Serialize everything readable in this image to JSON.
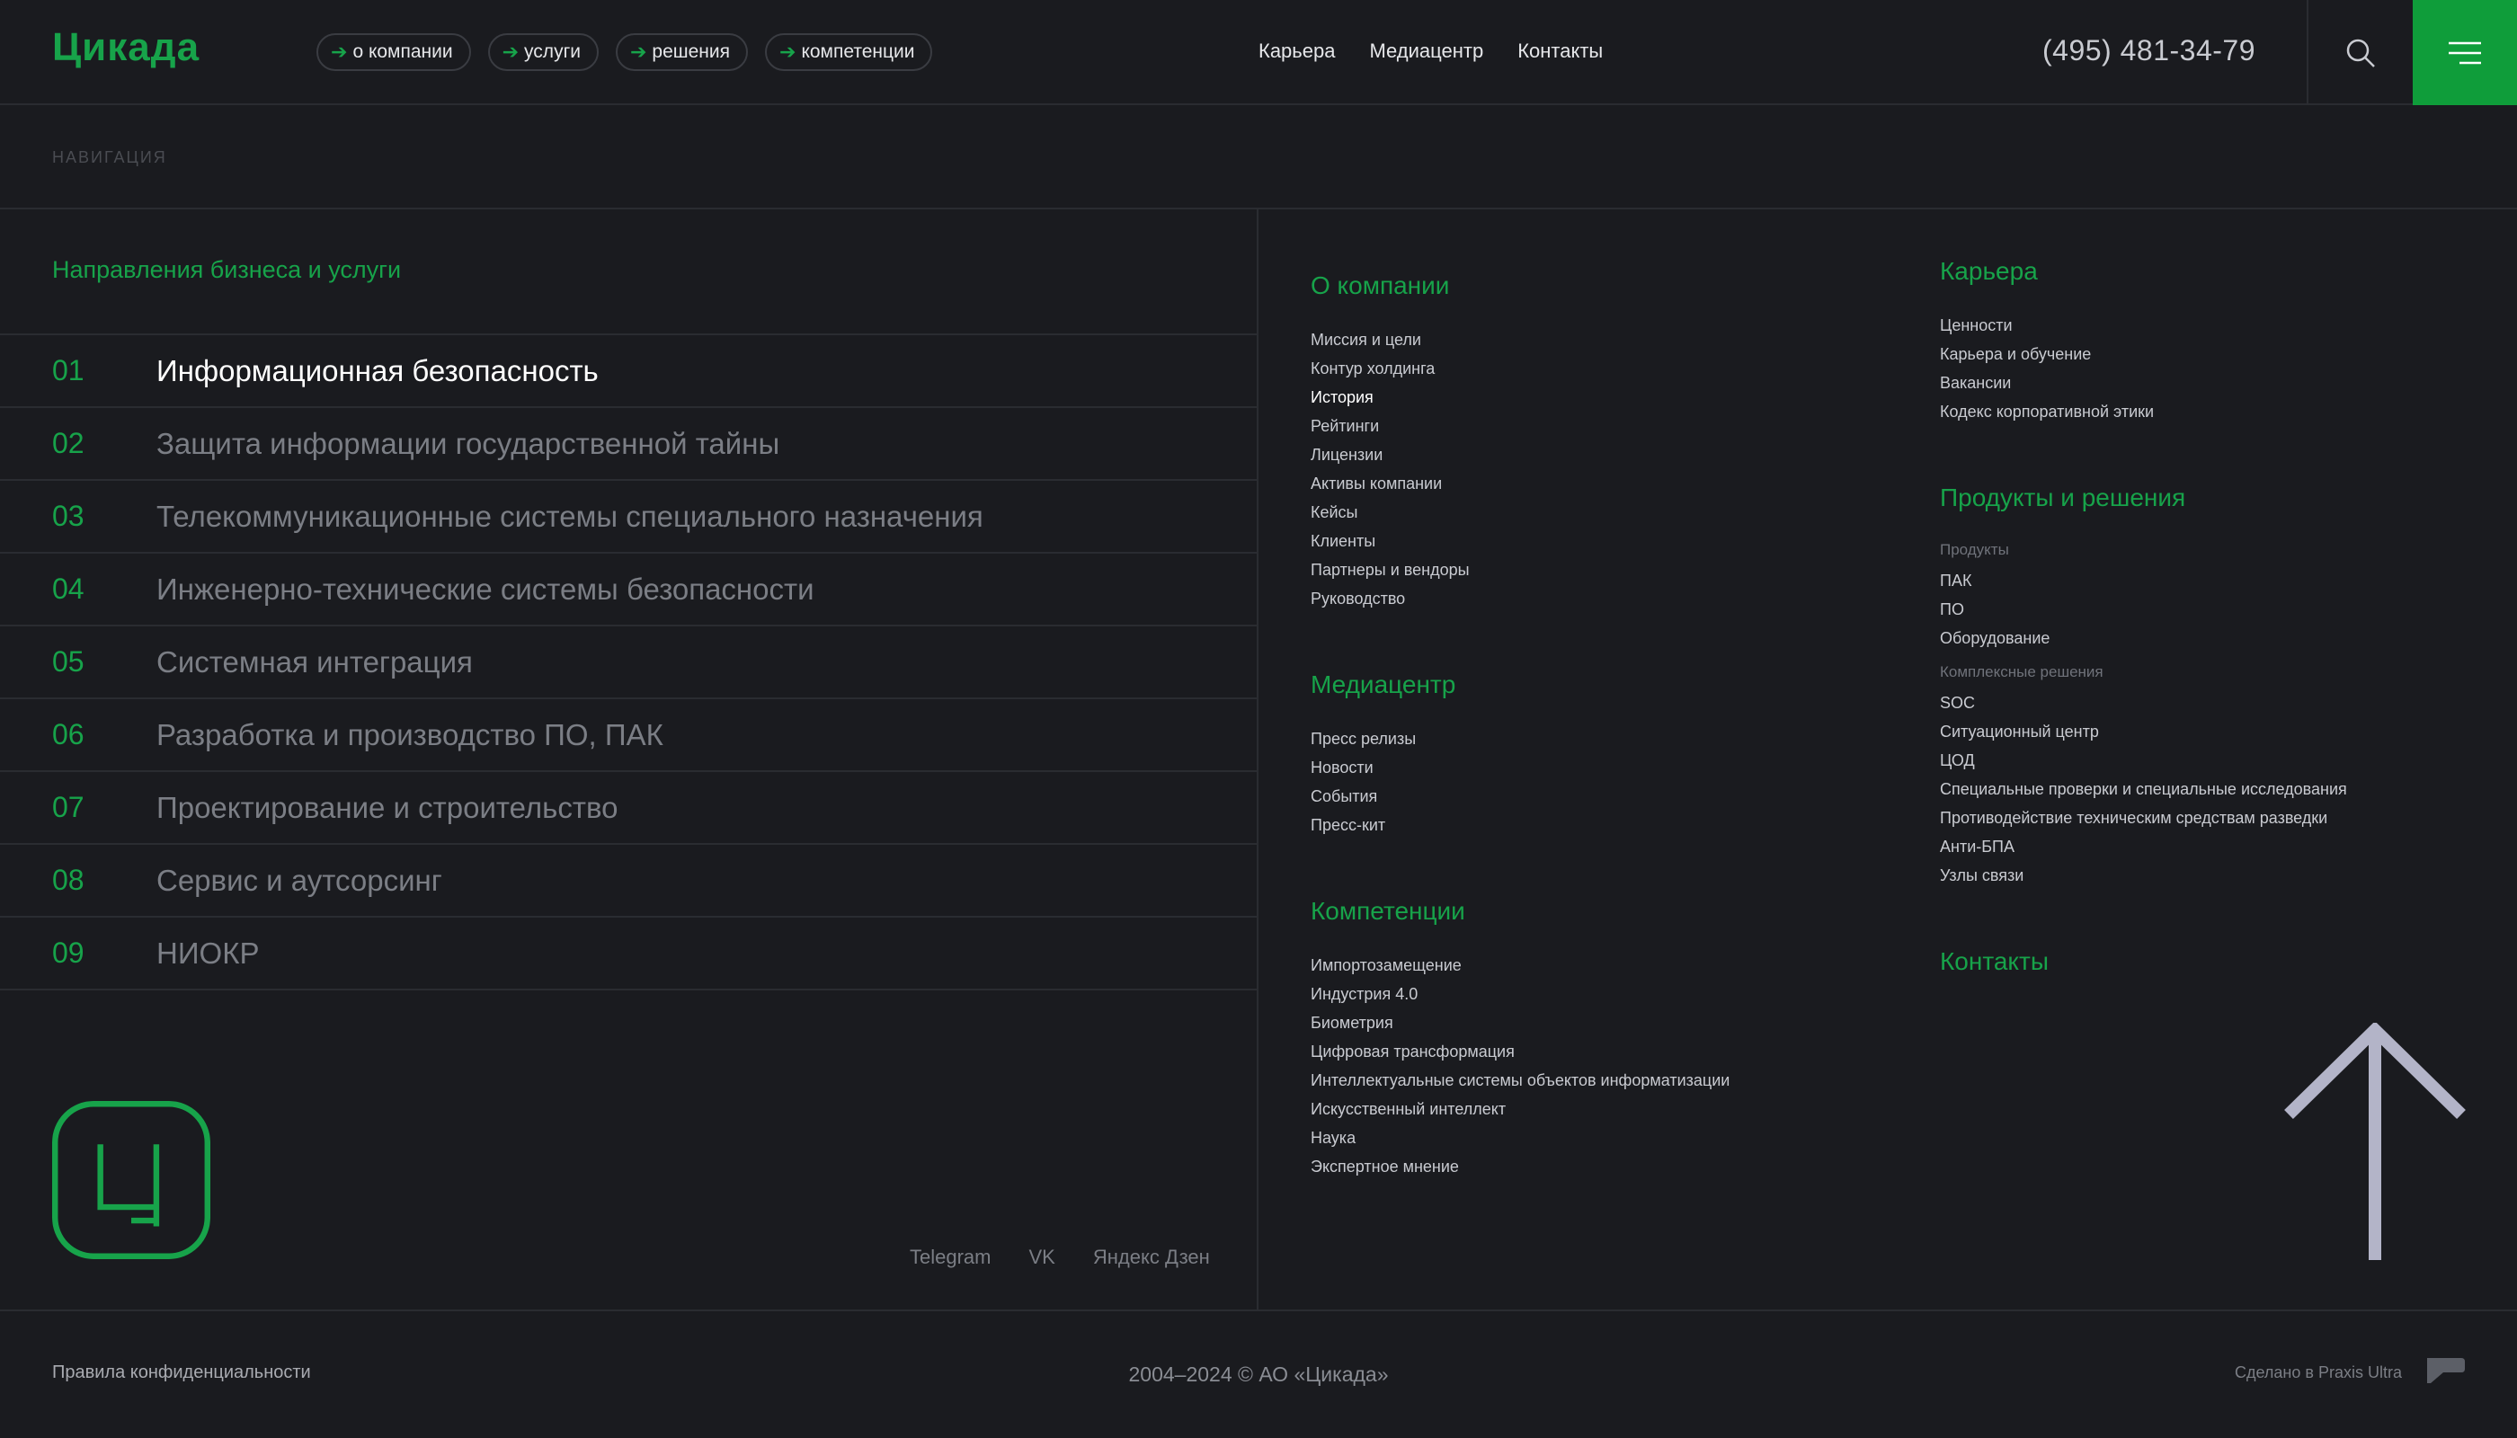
{
  "header": {
    "logo": "Цикада",
    "pills": [
      "о компании",
      "услуги",
      "решения",
      "компетенции"
    ],
    "topnav": [
      "Карьера",
      "Медиацентр",
      "Контакты"
    ],
    "phone": "(495) 481-34-79"
  },
  "navstrip_label": "НАВИГАЦИЯ",
  "left": {
    "title": "Направления бизнеса и услуги",
    "directions": [
      {
        "num": "01",
        "label": "Информационная безопасность"
      },
      {
        "num": "02",
        "label": "Защита информации государственной тайны"
      },
      {
        "num": "03",
        "label": "Телекоммуникационные системы специального назначения"
      },
      {
        "num": "04",
        "label": "Инженерно-технические системы безопасности"
      },
      {
        "num": "05",
        "label": "Системная интеграция"
      },
      {
        "num": "06",
        "label": "Разработка и производство ПО, ПАК"
      },
      {
        "num": "07",
        "label": "Проектирование и строительство"
      },
      {
        "num": "08",
        "label": "Сервис и аутсорсинг"
      },
      {
        "num": "09",
        "label": "НИОКР"
      }
    ],
    "socials": [
      "Telegram",
      "VK",
      "Яндекс Дзен"
    ]
  },
  "about": {
    "title": "О компании",
    "items": [
      "Миссия и цели",
      "Контур холдинга",
      "История",
      "Рейтинги",
      "Лицензии",
      "Активы компании",
      "Кейсы",
      "Клиенты",
      "Партнеры и вендоры",
      "Руководство"
    ]
  },
  "media": {
    "title": "Медиацентр",
    "items": [
      "Пресс релизы",
      "Новости",
      "События",
      "Пресс-кит"
    ]
  },
  "competencies": {
    "title": "Компетенции",
    "items": [
      "Импортозамещение",
      "Индустрия 4.0",
      "Биометрия",
      "Цифровая трансформация",
      "Интеллектуальные системы объектов информатизации",
      "Искусственный интеллект",
      "Наука",
      "Экспертное мнение"
    ]
  },
  "career": {
    "title": "Карьера",
    "items": [
      "Ценности",
      "Карьера и обучение",
      "Вакансии",
      "Кодекс корпоративной этики"
    ]
  },
  "products": {
    "title": "Продукты и решения",
    "sub1": "Продукты",
    "items1": [
      "ПАК",
      "ПО",
      "Оборудование"
    ],
    "sub2": "Комплексные решения",
    "items2": [
      "SOC",
      "Ситуационный центр",
      "ЦОД",
      "Специальные проверки и специальные исследования",
      "Противодействие техническим средствам разведки",
      "Анти-БПА",
      "Узлы связи"
    ]
  },
  "contacts": {
    "title": "Контакты"
  },
  "footer": {
    "privacy": "Правила конфиденциальности",
    "copyright": "2004–2024 © АО «Цикада»",
    "madeby": "Сделано в Praxis Ultra"
  },
  "colors": {
    "accent": "#17a34a",
    "bg": "#1a1b1f"
  }
}
